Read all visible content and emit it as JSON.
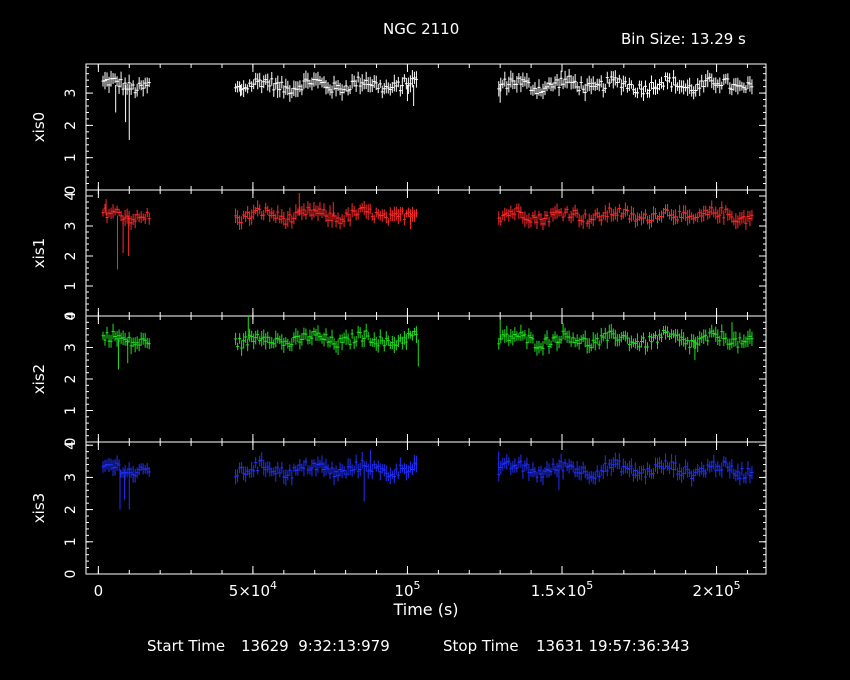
{
  "title": "NGC 2110",
  "bin_size": "Bin Size: 13.29 s",
  "footer": {
    "start_label": "Start Time",
    "start_value": "13629  9:32:13:979",
    "stop_label": "Stop Time",
    "stop_value": "13631 19:57:36:343"
  },
  "chart_data": {
    "type": "line",
    "title": "NGC 2110",
    "xlabel": "Time (s)",
    "xlim": [
      -4000,
      216000
    ],
    "x_ticks": [
      {
        "value": 0,
        "base": "0",
        "exp": ""
      },
      {
        "value": 50000,
        "base": "5×10",
        "exp": "4"
      },
      {
        "value": 100000,
        "base": "10",
        "exp": "5"
      },
      {
        "value": 150000,
        "base": "1.5×10",
        "exp": "5"
      },
      {
        "value": 200000,
        "base": "2×10",
        "exp": "5"
      }
    ],
    "gaps": [
      [
        17000,
        44000
      ],
      [
        103000,
        129000
      ]
    ],
    "grid": false,
    "panels": [
      {
        "ylabel": "xis0",
        "color": "#ffffff",
        "ylim": [
          0,
          3.9
        ],
        "yticks": [
          0,
          1,
          2,
          3
        ],
        "mean": 3.25,
        "dips": [
          [
            5600,
            2.4
          ],
          [
            8800,
            2.1
          ],
          [
            10000,
            1.55
          ],
          [
            46000,
            2.9
          ],
          [
            58000,
            2.85
          ],
          [
            100000,
            2.75
          ],
          [
            102000,
            2.6
          ],
          [
            130000,
            2.7
          ]
        ]
      },
      {
        "ylabel": "xis1",
        "color": "#ff2a2a",
        "ylim": [
          0,
          4.2
        ],
        "yticks": [
          0,
          1,
          2,
          3,
          4
        ],
        "mean": 3.35,
        "dips": [
          [
            6200,
            1.55
          ],
          [
            8000,
            2.1
          ],
          [
            9800,
            2.0
          ],
          [
            2500,
            3.9
          ],
          [
            65000,
            4.1
          ],
          [
            76000,
            3.8
          ],
          [
            101000,
            2.9
          ]
        ]
      },
      {
        "ylabel": "xis2",
        "color": "#20e020",
        "ylim": [
          0,
          4.0
        ],
        "yticks": [
          0,
          1,
          2,
          3,
          4
        ],
        "mean": 3.25,
        "dips": [
          [
            6500,
            2.3
          ],
          [
            9500,
            2.5
          ],
          [
            48500,
            4.0
          ],
          [
            103500,
            2.4
          ],
          [
            130000,
            3.9
          ],
          [
            193000,
            2.6
          ],
          [
            205000,
            3.8
          ]
        ]
      },
      {
        "ylabel": "xis3",
        "color": "#2030ff",
        "ylim": [
          0,
          4.1
        ],
        "yticks": [
          0,
          1,
          2,
          3,
          4
        ],
        "mean": 3.25,
        "dips": [
          [
            7000,
            2.0
          ],
          [
            8500,
            2.3
          ],
          [
            10000,
            2.0
          ],
          [
            86000,
            2.25
          ],
          [
            88000,
            3.85
          ],
          [
            129500,
            3.8
          ],
          [
            149000,
            2.6
          ]
        ]
      }
    ]
  }
}
